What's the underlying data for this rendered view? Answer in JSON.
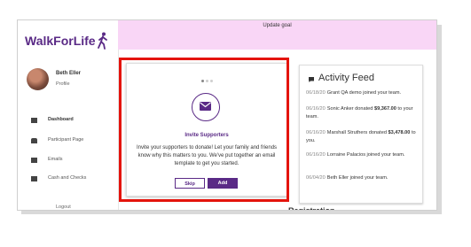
{
  "app": {
    "logo": "WalkForLife"
  },
  "banner": {
    "text": "Update goal"
  },
  "user": {
    "name": "Beth Eller",
    "role": "Profile"
  },
  "nav": [
    {
      "label": "Dashboard",
      "icon": "dashboard-icon",
      "active": true
    },
    {
      "label": "Participant Page",
      "icon": "person-icon"
    },
    {
      "label": "Emails",
      "icon": "mail-icon"
    },
    {
      "label": "Cash and Checks",
      "icon": "card-icon"
    }
  ],
  "logout": "Logout",
  "card": {
    "title": "Invite Supporters",
    "desc": "Invite your supporters to donate! Let your family and friends know why this matters to you. We've put together an email template to get you started.",
    "skip": "Skip",
    "add": "Add",
    "icon": "envelope-icon"
  },
  "feed": {
    "title": "Activity Feed",
    "items": [
      {
        "date": "06/18/20",
        "pre": "Grant QA demo joined your team.",
        "amount": "",
        "post": ""
      },
      {
        "date": "06/16/20",
        "pre": "Sonic Anker donated",
        "amount": "$9,367.00",
        "post": "to your team."
      },
      {
        "date": "06/16/20",
        "pre": "Marshall Struthers donated",
        "amount": "$3,478.00",
        "post": "to you."
      },
      {
        "date": "06/16/20",
        "pre": "Lorraine Palacios joined your team.",
        "amount": "",
        "post": ""
      },
      {
        "date": "06/04/20",
        "pre": "Beth Eller joined your team.",
        "amount": "",
        "post": ""
      }
    ]
  },
  "registration_heading": "Registration",
  "colors": {
    "brand": "#5a2a86",
    "banner": "#f9d6f6",
    "highlight": "#e4140d"
  }
}
